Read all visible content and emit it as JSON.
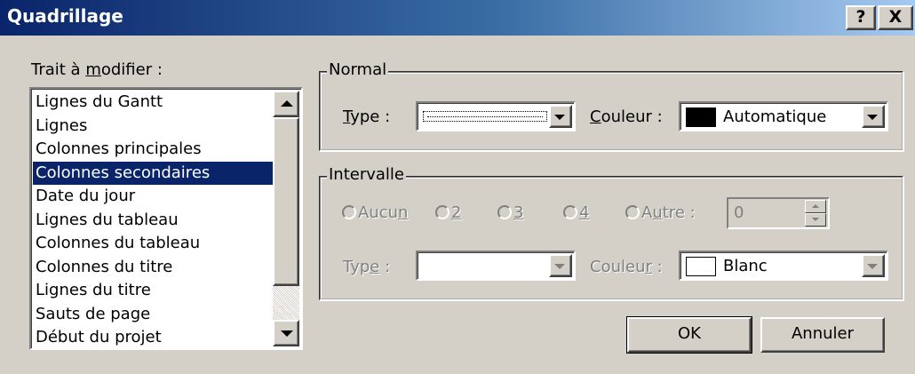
{
  "window": {
    "title": "Quadrillage",
    "help_label": "?",
    "close_label": "X"
  },
  "list": {
    "label_pre": "Trait à ",
    "label_accel": "m",
    "label_post": "odifier :",
    "items": [
      "Lignes du Gantt",
      "Lignes",
      "Colonnes principales",
      "Colonnes secondaires",
      "Date du jour",
      "Lignes du tableau",
      "Colonnes du tableau",
      "Colonnes du titre",
      "Lignes du titre",
      "Sauts de page",
      "Début du projet"
    ],
    "selected_item": "Colonnes secondaires"
  },
  "normal": {
    "legend": "Normal",
    "type_accel": "T",
    "type_post": "ype :",
    "couleur_accel": "C",
    "couleur_post": "ouleur :",
    "couleur_value": "Automatique",
    "couleur_swatch": "#000000"
  },
  "intervalle": {
    "legend": "Intervalle",
    "radios": {
      "aucun_pre": "Aucu",
      "aucun_accel": "n",
      "aucun_post": "",
      "r2_accel": "2",
      "r3_accel": "3",
      "r4_accel": "4",
      "autre_pre": "A",
      "autre_accel": "u",
      "autre_post": "tre :"
    },
    "autre_value": "0",
    "type_pre": "Typ",
    "type_accel": "e",
    "type_post": " :",
    "couleur_pre": "Couleu",
    "couleur_accel": "r",
    "couleur_post": " :",
    "couleur_value": "Blanc",
    "couleur_swatch": "#ffffff"
  },
  "buttons": {
    "ok": "OK",
    "cancel": "Annuler"
  }
}
